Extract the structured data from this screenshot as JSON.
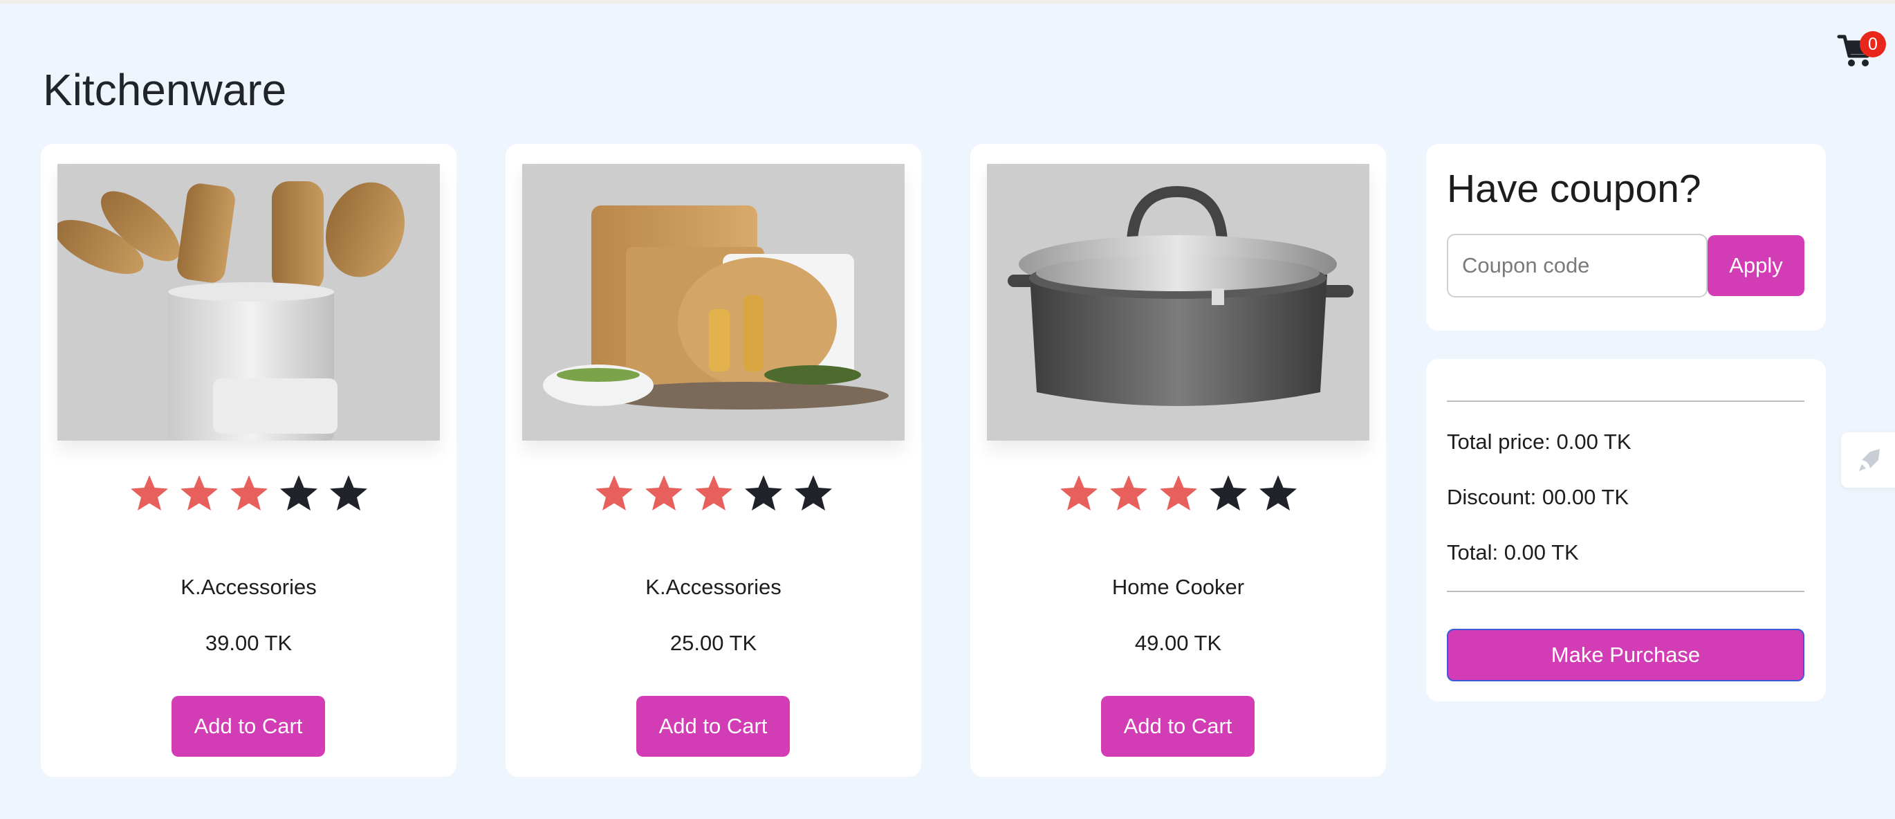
{
  "page": {
    "title": "Kitchenware"
  },
  "cart": {
    "count": "0",
    "icon": "cart-icon"
  },
  "products": [
    {
      "name": "K.Accessories",
      "price": "39.00 TK",
      "rating": 3,
      "max_rating": 5,
      "button": "Add to Cart",
      "image": "kitchen-utensils-image"
    },
    {
      "name": "K.Accessories",
      "price": "25.00 TK",
      "rating": 3,
      "max_rating": 5,
      "button": "Add to Cart",
      "image": "cutting-boards-image"
    },
    {
      "name": "Home Cooker",
      "price": "49.00 TK",
      "rating": 3,
      "max_rating": 5,
      "button": "Add to Cart",
      "image": "cooking-pot-image"
    }
  ],
  "coupon": {
    "title": "Have coupon?",
    "placeholder": "Coupon code",
    "apply_label": "Apply"
  },
  "summary": {
    "total_price": "Total price: 0.00 TK",
    "discount": "Discount: 00.00 TK",
    "total": "Total: 0.00 TK",
    "purchase_label": "Make Purchase"
  },
  "colors": {
    "accent": "#d23cb4",
    "star_filled": "#e8605c",
    "star_empty": "#1f2329",
    "badge": "#e8261b",
    "background": "#eff5fd"
  }
}
